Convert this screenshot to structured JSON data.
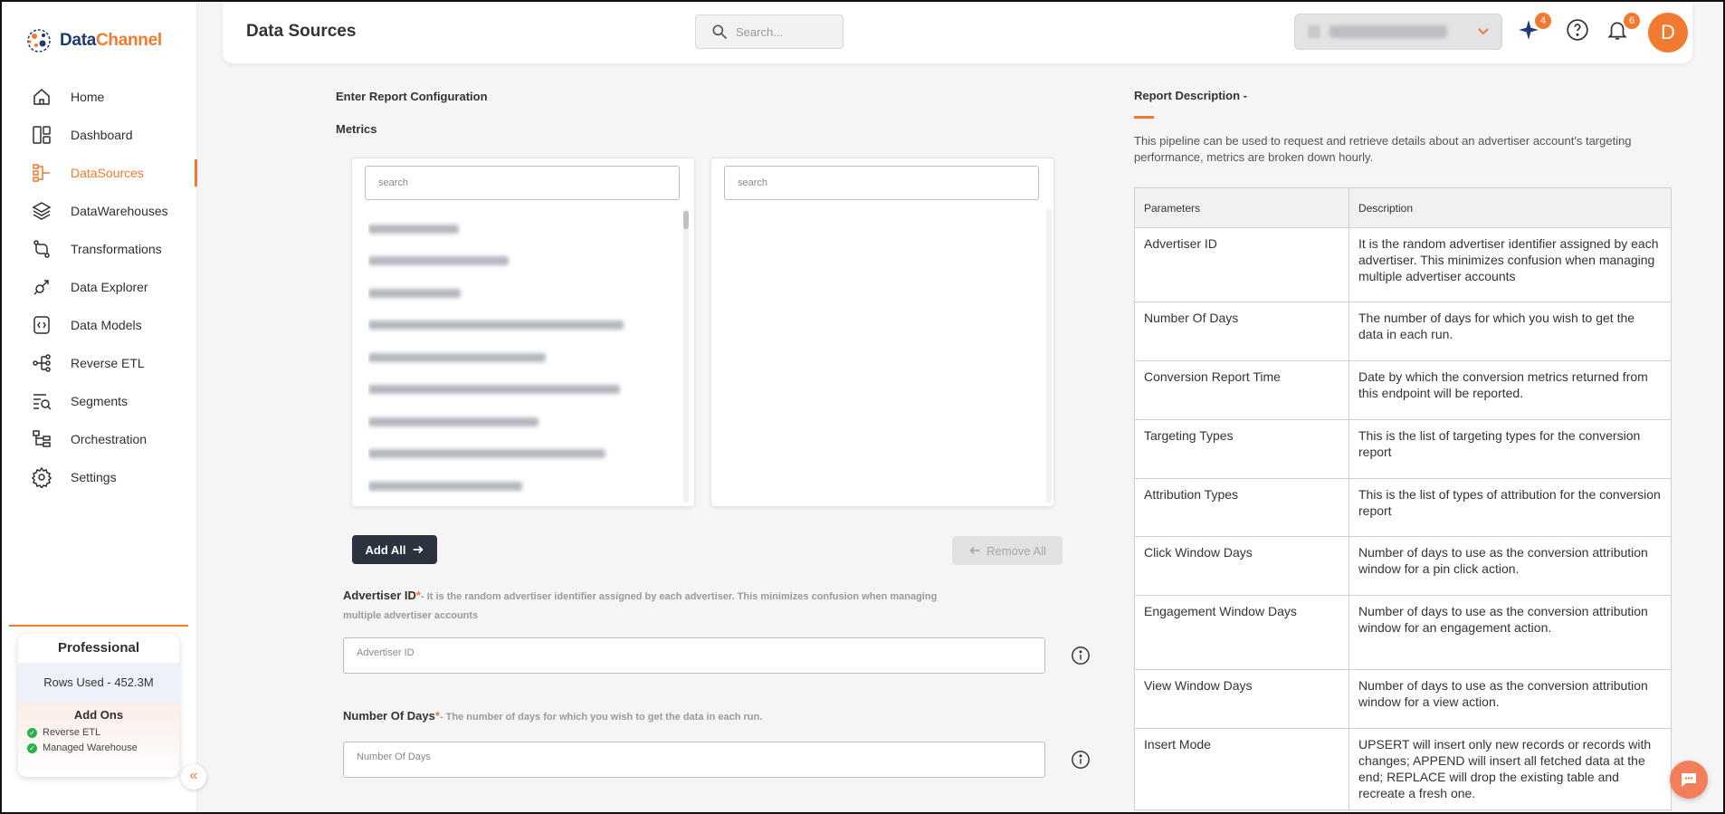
{
  "app": {
    "brand_part1": "Data",
    "brand_part2": "Channel",
    "brand_color": "#f07a2f",
    "page_title": "Data Sources"
  },
  "sidebar": {
    "items": [
      {
        "label": "Home",
        "icon": "home-icon"
      },
      {
        "label": "Dashboard",
        "icon": "dashboard-icon"
      },
      {
        "label": "DataSources",
        "icon": "datasources-icon",
        "active": true
      },
      {
        "label": "DataWarehouses",
        "icon": "layers-icon"
      },
      {
        "label": "Transformations",
        "icon": "transform-icon"
      },
      {
        "label": "Data Explorer",
        "icon": "explorer-icon"
      },
      {
        "label": "Data Models",
        "icon": "data-models-icon"
      },
      {
        "label": "Reverse ETL",
        "icon": "reverse-etl-icon"
      },
      {
        "label": "Segments",
        "icon": "segments-icon"
      },
      {
        "label": "Orchestration",
        "icon": "orchestration-icon"
      },
      {
        "label": "Settings",
        "icon": "gear-icon"
      }
    ],
    "plan": {
      "title": "Professional",
      "rows_used": "Rows Used - 452.3M",
      "addons_title": "Add Ons",
      "addons": [
        "Reverse ETL",
        "Managed Warehouse"
      ]
    }
  },
  "header": {
    "search_placeholder": "Search...",
    "ai_badge": "4",
    "notif_badge": "6",
    "avatar_letter": "D"
  },
  "config": {
    "heading": "Enter Report Configuration",
    "metrics_label": "Metrics",
    "left_search_placeholder": "search",
    "right_search_placeholder": "search",
    "add_all": "Add All",
    "remove_all": "Remove All",
    "advertiser_id_label": "Advertiser ID",
    "advertiser_id_hint": "- It is the random advertiser identifier assigned by each advertiser. This minimizes confusion when managing multiple advertiser accounts",
    "advertiser_id_placeholder": "Advertiser ID",
    "days_label": "Number Of Days",
    "days_hint": "- The number of days for which you wish to get the data in each run.",
    "days_placeholder": "Number Of Days",
    "required_mark": "*"
  },
  "report": {
    "title": "Report Description -",
    "description": "This pipeline can be used to request and retrieve details about an advertiser account's targeting performance, metrics are broken down hourly.",
    "col_params": "Parameters",
    "col_desc": "Description",
    "rows": [
      {
        "param": "Advertiser ID",
        "desc": "It is the random advertiser identifier assigned by each advertiser. This minimizes confusion when managing multiple advertiser accounts"
      },
      {
        "param": "Number Of Days",
        "desc": "The number of days for which you wish to get the data in each run."
      },
      {
        "param": "Conversion Report Time",
        "desc": "Date by which the conversion metrics returned from this endpoint will be reported."
      },
      {
        "param": "Targeting Types",
        "desc": "This is the list of targeting types for the conversion report"
      },
      {
        "param": "Attribution Types",
        "desc": "This is the list of types of attribution for the conversion report"
      },
      {
        "param": "Click Window Days",
        "desc": "Number of days to use as the conversion attribution window for a pin click action."
      },
      {
        "param": "Engagement Window Days",
        "desc": "Number of days to use as the conversion attribution window for an engagement action."
      },
      {
        "param": "View Window Days",
        "desc": "Number of days to use as the conversion attribution window for a view action."
      },
      {
        "param": "Insert Mode",
        "desc": "UPSERT will insert only new records or records with changes; APPEND will insert all fetched data at the end; REPLACE will drop the existing table and recreate a fresh one."
      }
    ]
  }
}
